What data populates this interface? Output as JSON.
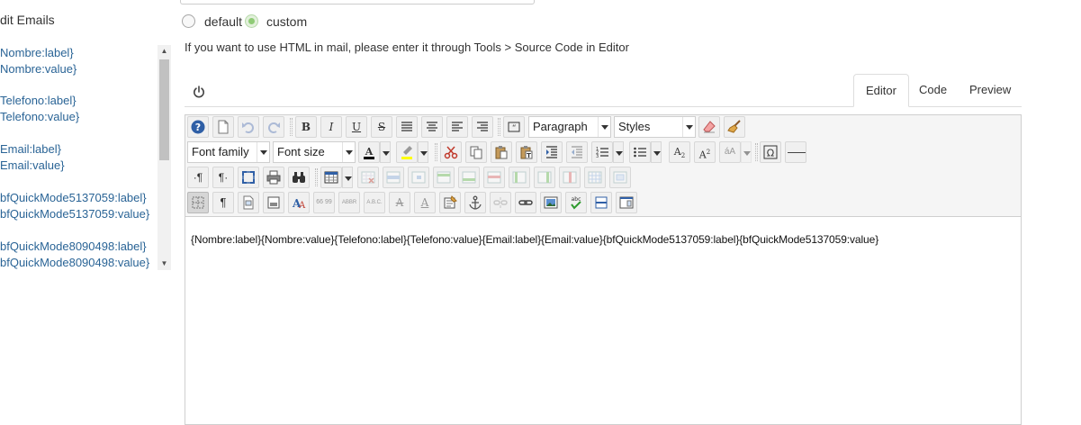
{
  "left_panel": {
    "title": "dit Emails",
    "placeholders": [
      [
        "Nombre:label}",
        "Nombre:value}"
      ],
      [
        "Telefono:label}",
        "Telefono:value}"
      ],
      [
        "Email:label}",
        "Email:value}"
      ],
      [
        "bfQuickMode5137059:label}",
        "bfQuickMode5137059:value}"
      ],
      [
        "bfQuickMode8090498:label}",
        "bfQuickMode8090498:value}"
      ]
    ]
  },
  "template_mode": {
    "default_label": "default",
    "custom_label": "custom",
    "selected": "custom"
  },
  "hint": "If you want to use HTML in mail, please enter it through Tools > Source Code in Editor",
  "tabs": [
    {
      "label": "Editor",
      "active": true
    },
    {
      "label": "Code",
      "active": false
    },
    {
      "label": "Preview",
      "active": false
    }
  ],
  "toolbar": {
    "format_value": "Paragraph",
    "styles_value": "Styles",
    "font_family_value": "Font family",
    "font_size_value": "Font size"
  },
  "editor_content": "{Nombre:label}{Nombre:value}{Telefono:label}{Telefono:value}{Email:label}{Email:value}{bfQuickMode5137059:label}{bfQuickMode5137059:value}",
  "colors": {
    "link": "#2a6496",
    "radio_checked": "#8fcb76",
    "text_color_indicator": "#000000",
    "highlight_indicator": "#ffff00"
  }
}
